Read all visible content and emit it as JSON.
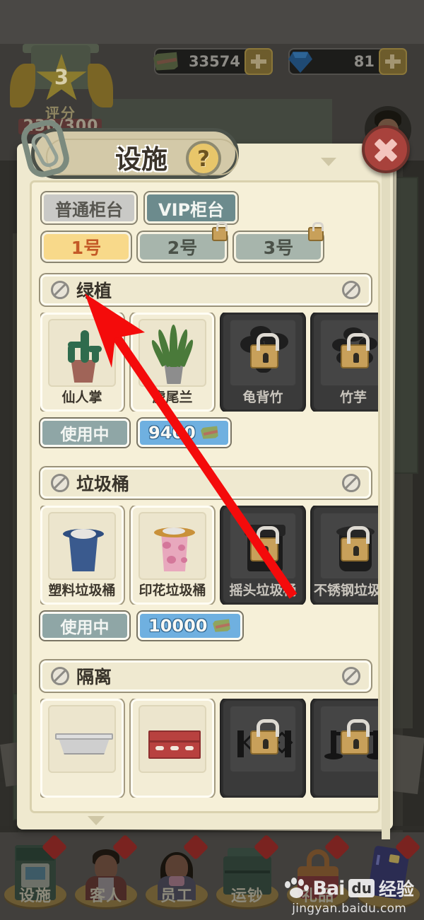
{
  "hud": {
    "rating": {
      "stars": "3",
      "label": "评分",
      "progress": "230/300"
    },
    "money": {
      "value": "33574",
      "icon": "money-icon",
      "add_label": "+"
    },
    "gems": {
      "value": "81",
      "icon": "gem-icon",
      "add_label": "+"
    },
    "avatar": "player-avatar"
  },
  "dialog": {
    "title": "设施",
    "help_label": "?",
    "close_label": "×",
    "clip_icon": "paperclip-icon",
    "counter_tabs": [
      {
        "label": "普通柜台",
        "active": false
      },
      {
        "label": "VIP柜台",
        "active": true
      }
    ],
    "slot_tabs": [
      {
        "label": "1号",
        "state": "selected"
      },
      {
        "label": "2号",
        "state": "locked"
      },
      {
        "label": "3号",
        "state": "locked"
      }
    ],
    "sections": [
      {
        "title": "绿植",
        "left_icon": "ban-icon",
        "right_icon": "ban-icon",
        "items": [
          {
            "name": "仙人掌",
            "locked": false
          },
          {
            "name": "虎尾兰",
            "locked": false
          },
          {
            "name": "龟背竹",
            "locked": true
          },
          {
            "name": "竹芋",
            "locked": true
          }
        ],
        "status_label": "使用中",
        "price": "9400"
      },
      {
        "title": "垃圾桶",
        "left_icon": "ban-icon",
        "right_icon": "ban-icon",
        "items": [
          {
            "name": "塑料垃圾桶",
            "locked": false
          },
          {
            "name": "印花垃圾桶",
            "locked": false
          },
          {
            "name": "摇头垃圾桶",
            "locked": true
          },
          {
            "name": "不锈钢垃圾桶",
            "locked": true
          }
        ],
        "status_label": "使用中",
        "price": "10000"
      },
      {
        "title": "隔离",
        "left_icon": "ban-icon",
        "right_icon": "ban-icon",
        "items": [
          {
            "name": "",
            "locked": false
          },
          {
            "name": "",
            "locked": false
          },
          {
            "name": "",
            "locked": true
          },
          {
            "name": "",
            "locked": true
          }
        ],
        "status_label": "",
        "price": ""
      }
    ]
  },
  "bottom_nav": [
    {
      "label": "设施",
      "icon": "atm-icon",
      "badge": true
    },
    {
      "label": "客人",
      "icon": "guest-icon",
      "badge": true
    },
    {
      "label": "员工",
      "icon": "staff-icon",
      "badge": true
    },
    {
      "label": "运钞",
      "icon": "cash-van-icon",
      "badge": true
    },
    {
      "label": "礼品",
      "icon": "gift-bag-icon",
      "badge": true
    },
    {
      "label": "",
      "icon": "bank-card-icon",
      "badge": true
    }
  ],
  "watermark": {
    "bai": "Bai",
    "du": "du",
    "jingyan": "经验",
    "url": "jingyan.baidu.com"
  },
  "annotation": {
    "type": "red-arrow",
    "color": "#f40b0b"
  },
  "colors": {
    "paper": "#f6f0d8",
    "accent_yellow": "#f8d98a",
    "accent_blue": "#6fb0e0",
    "tab_active": "#6c8b8d",
    "close_red": "#a8423c"
  }
}
